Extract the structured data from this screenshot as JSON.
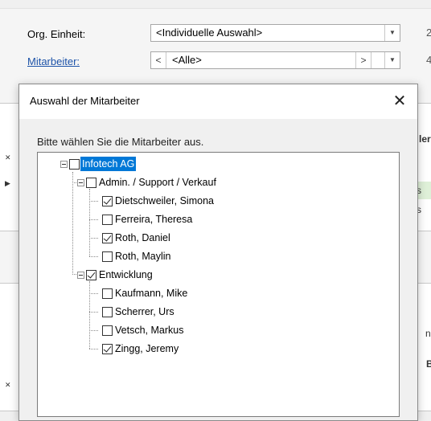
{
  "background": {
    "org_unit_label": "Org. Einheit:",
    "org_unit_value": "<Individuelle Auswahl>",
    "employees_label": "Mitarbeiter:",
    "employees_prev": "<",
    "employees_value": "<Alle>",
    "employees_next": ">",
    "fragments": {
      "header_ler": "ler",
      "row1_s": "s",
      "row2_s": "s",
      "n_text": "n",
      "b_text": "B"
    }
  },
  "dialog": {
    "title": "Auswahl der Mitarbeiter",
    "instruction": "Bitte wählen Sie die Mitarbeiter aus.",
    "tree": [
      {
        "label": "Infotech AG",
        "checked": false,
        "selected": true
      },
      {
        "label": "Admin. / Support / Verkauf",
        "checked": false
      },
      {
        "label": "Dietschweiler, Simona",
        "checked": true
      },
      {
        "label": "Ferreira, Theresa",
        "checked": false
      },
      {
        "label": "Roth, Daniel",
        "checked": true
      },
      {
        "label": "Roth, Maylin",
        "checked": false
      },
      {
        "label": "Entwicklung",
        "checked": true
      },
      {
        "label": "Kaufmann, Mike",
        "checked": false
      },
      {
        "label": "Scherrer, Urs",
        "checked": false
      },
      {
        "label": "Vetsch, Markus",
        "checked": false
      },
      {
        "label": "Zingg, Jeremy",
        "checked": true
      }
    ]
  }
}
